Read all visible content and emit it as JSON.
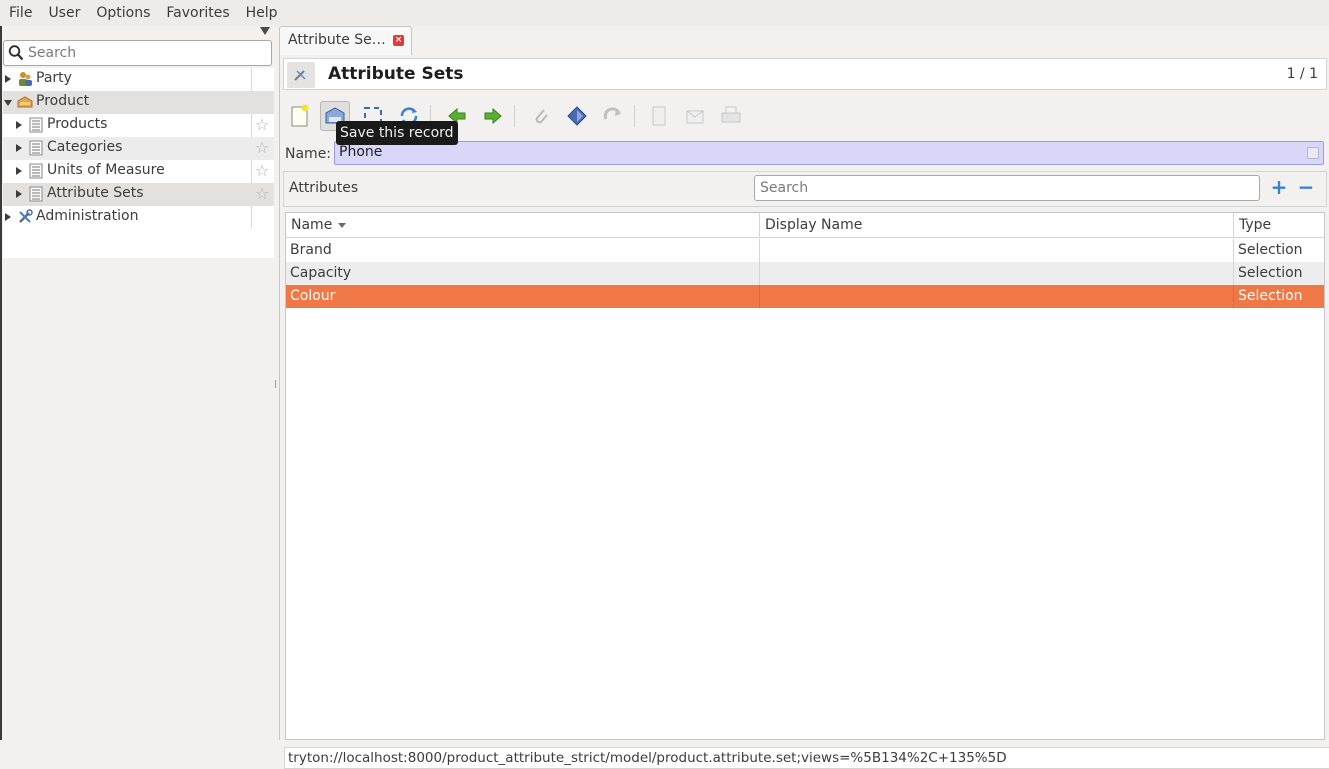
{
  "menubar": {
    "items": [
      "File",
      "User",
      "Options",
      "Favorites",
      "Help"
    ]
  },
  "sidebar": {
    "search_placeholder": "Search",
    "tree": [
      {
        "label": "Party",
        "icon": "party-icon",
        "expanded": false,
        "level": 0
      },
      {
        "label": "Product",
        "icon": "product-icon",
        "expanded": true,
        "level": 0
      },
      {
        "label": "Products",
        "icon": "list-icon",
        "level": 1,
        "favorite": false
      },
      {
        "label": "Categories",
        "icon": "list-icon",
        "level": 1,
        "favorite": false
      },
      {
        "label": "Units of Measure",
        "icon": "list-icon",
        "level": 1,
        "favorite": false
      },
      {
        "label": "Attribute Sets",
        "icon": "list-icon",
        "level": 1,
        "favorite": false,
        "selected": true
      },
      {
        "label": "Administration",
        "icon": "tools-icon",
        "expanded": false,
        "level": 0
      }
    ]
  },
  "tab": {
    "label": "Attribute Se…",
    "close_glyph": "×"
  },
  "form": {
    "title": "Attribute Sets",
    "record_count": "1 / 1",
    "name_label": "Name:",
    "name_value": "Phone",
    "tooltip": "Save this record"
  },
  "toolbar": {
    "buttons": [
      "new-record",
      "save-record",
      "switch-view",
      "reload",
      "previous",
      "next",
      "attachment",
      "action",
      "relate",
      "report",
      "email",
      "print"
    ]
  },
  "attributes": {
    "title": "Attributes",
    "search_placeholder": "Search",
    "add_label": "+",
    "remove_label": "−",
    "columns": [
      "Name",
      "Display Name",
      "Type"
    ],
    "rows": [
      {
        "name": "Brand",
        "display_name": "",
        "type": "Selection"
      },
      {
        "name": "Capacity",
        "display_name": "",
        "type": "Selection"
      },
      {
        "name": "Colour",
        "display_name": "",
        "type": "Selection",
        "selected": true
      }
    ]
  },
  "status": {
    "url": "tryton://localhost:8000/product_attribute_strict/model/product.attribute.set;views=%5B134%2C+135%5D"
  },
  "colors": {
    "selection": "#f07746",
    "name_field_bg": "#d9d7f7",
    "accent_blue": "#3a7fd5"
  }
}
